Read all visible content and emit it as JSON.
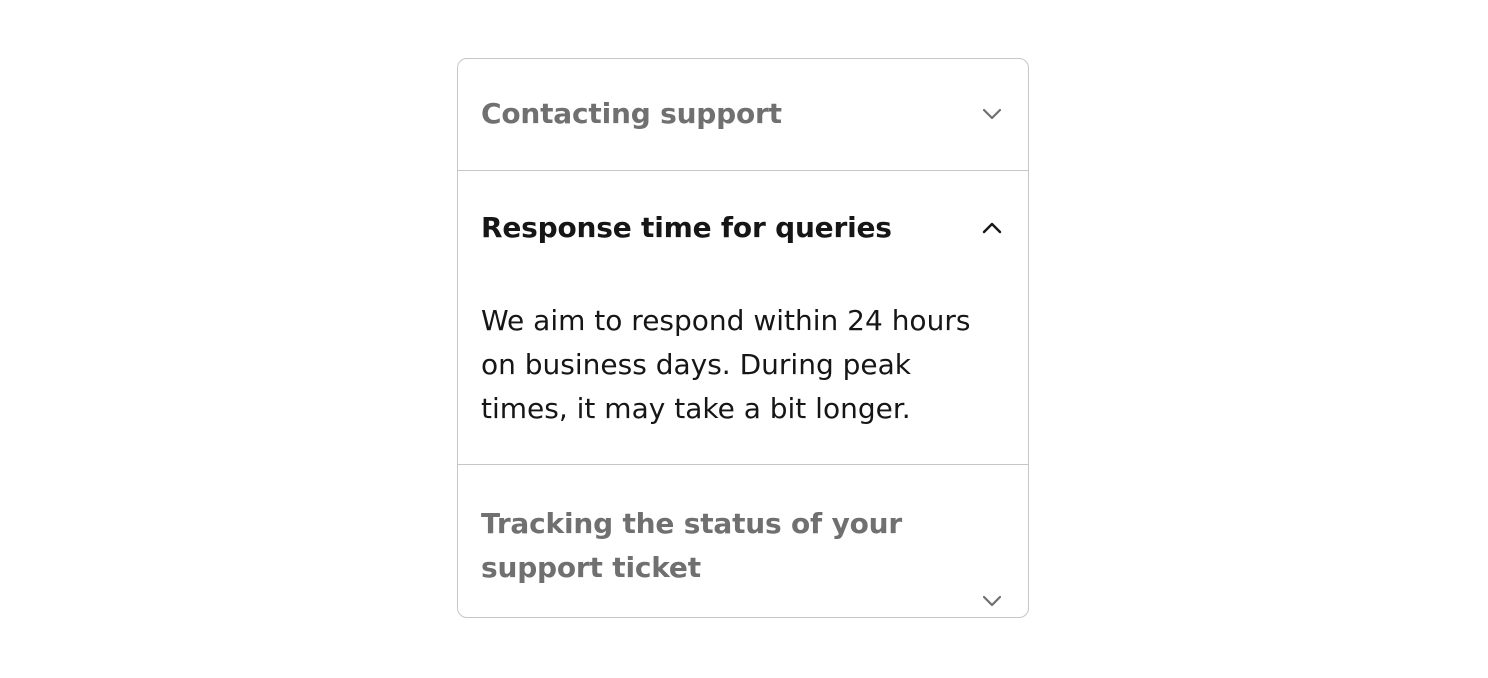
{
  "accordion": {
    "items": [
      {
        "title": "Contacting support",
        "expanded": false,
        "icon": "chevron-down-icon"
      },
      {
        "title": "Response time for queries",
        "expanded": true,
        "icon": "chevron-up-icon",
        "body": "We aim to respond within 24 hours on business days. During peak times, it may take a bit longer."
      },
      {
        "title": "Tracking the status of your support ticket",
        "expanded": false,
        "icon": "chevron-down-icon"
      }
    ]
  },
  "colors": {
    "border": "#c6c6c6",
    "collapsed_title": "#707070",
    "expanded_title": "#161616",
    "body_text": "#161616"
  }
}
